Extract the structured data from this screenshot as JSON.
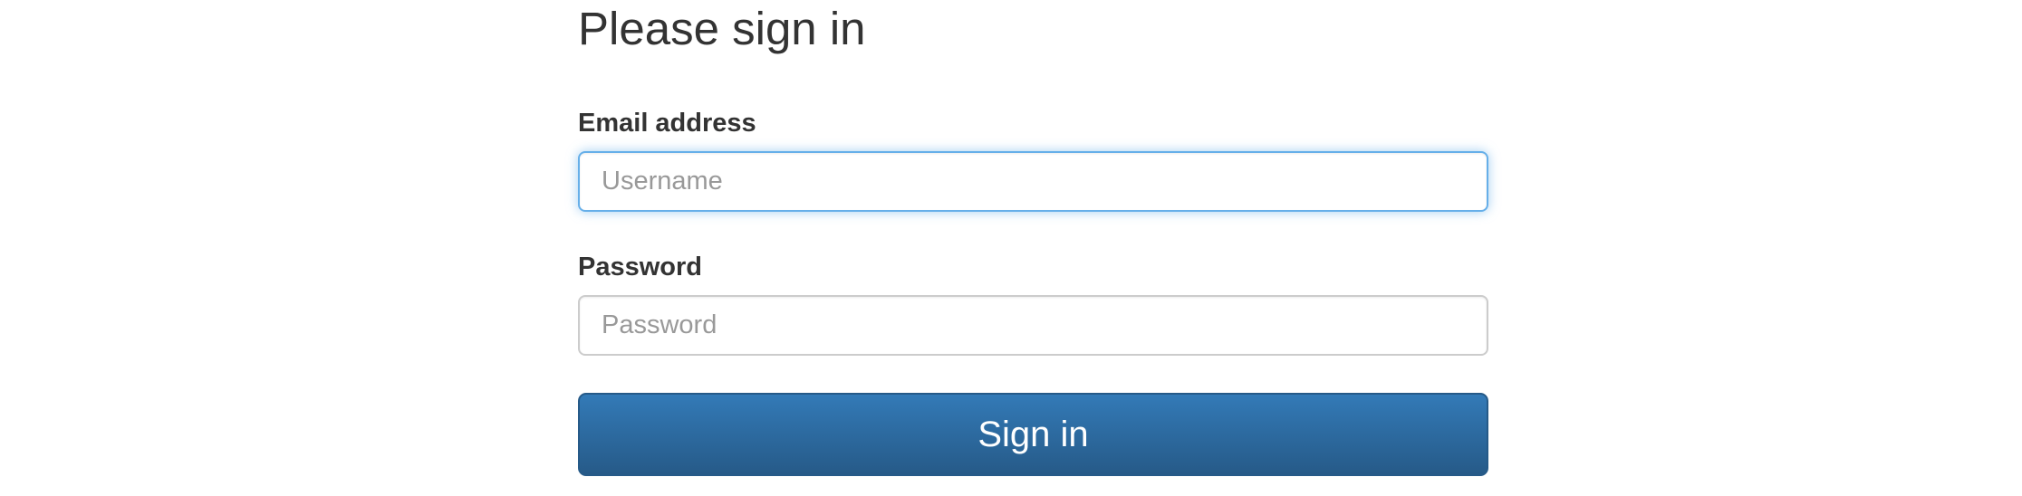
{
  "form": {
    "title": "Please sign in",
    "email_label": "Email address",
    "email_placeholder": "Username",
    "email_value": "",
    "password_label": "Password",
    "password_placeholder": "Password",
    "password_value": "",
    "submit_label": "Sign in"
  },
  "colors": {
    "button_top": "#337ab7",
    "button_bottom": "#265a88",
    "focus_border": "#66afe9",
    "text": "#333333"
  }
}
